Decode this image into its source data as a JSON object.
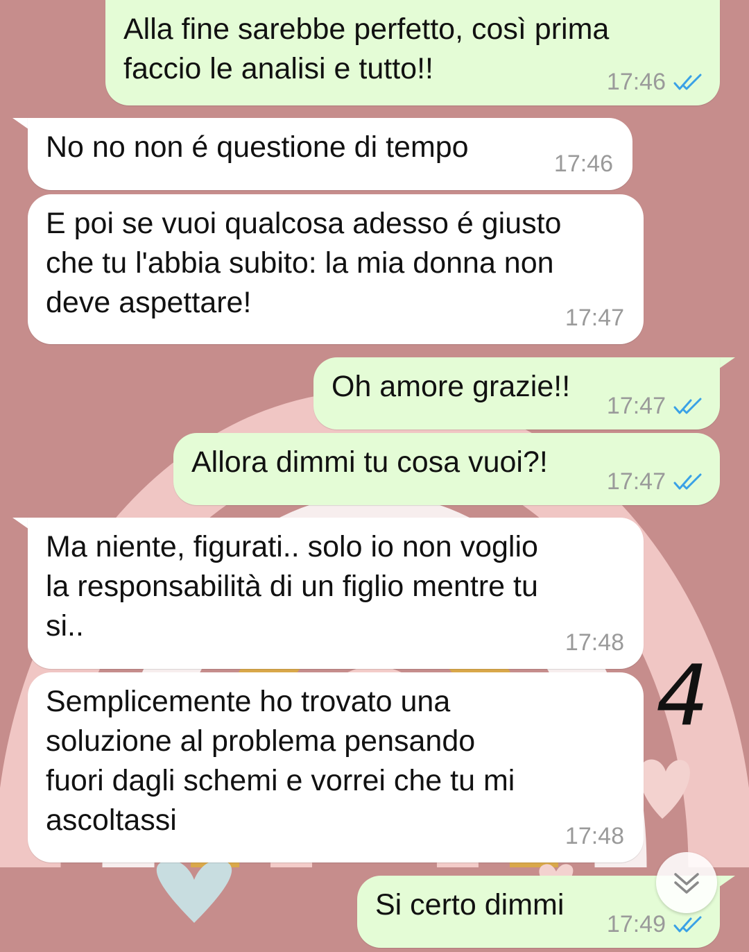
{
  "chat": {
    "messages": [
      {
        "direction": "outgoing",
        "text": "Alla fine sarebbe perfetto, così prima\nfaccio le analisi e tutto!!",
        "time": "17:46",
        "read": true
      },
      {
        "direction": "incoming",
        "text": "No no non é questione di tempo",
        "time": "17:46"
      },
      {
        "direction": "incoming",
        "text": "E poi se vuoi qualcosa adesso é giusto\nche tu l'abbia subito: la mia donna non\ndeve aspettare!",
        "time": "17:47"
      },
      {
        "direction": "outgoing",
        "text": "Oh amore grazie!!",
        "time": "17:47",
        "read": true
      },
      {
        "direction": "outgoing",
        "text": "Allora dimmi tu cosa vuoi?!",
        "time": "17:47",
        "read": true
      },
      {
        "direction": "incoming",
        "text": "Ma niente, figurati.. solo io non voglio\nla responsabilità di un figlio mentre tu\nsi..",
        "time": "17:48"
      },
      {
        "direction": "incoming",
        "text": "Semplicemente ho trovato una\nsoluzione al problema pensando\nfuori dagli schemi e vorrei che tu mi\nascoltassi",
        "time": "17:48"
      },
      {
        "direction": "outgoing",
        "text": "Si certo dimmi",
        "time": "17:49",
        "read": true
      }
    ]
  },
  "annotation": {
    "number": "4"
  },
  "colors": {
    "background": "#c68d8c",
    "outgoing_bubble": "#e4fcd6",
    "incoming_bubble": "#ffffff",
    "read_ticks": "#3aa1e6"
  },
  "icons": {
    "read_receipt": "double-check-icon",
    "scroll_down": "chevron-double-down-icon"
  }
}
